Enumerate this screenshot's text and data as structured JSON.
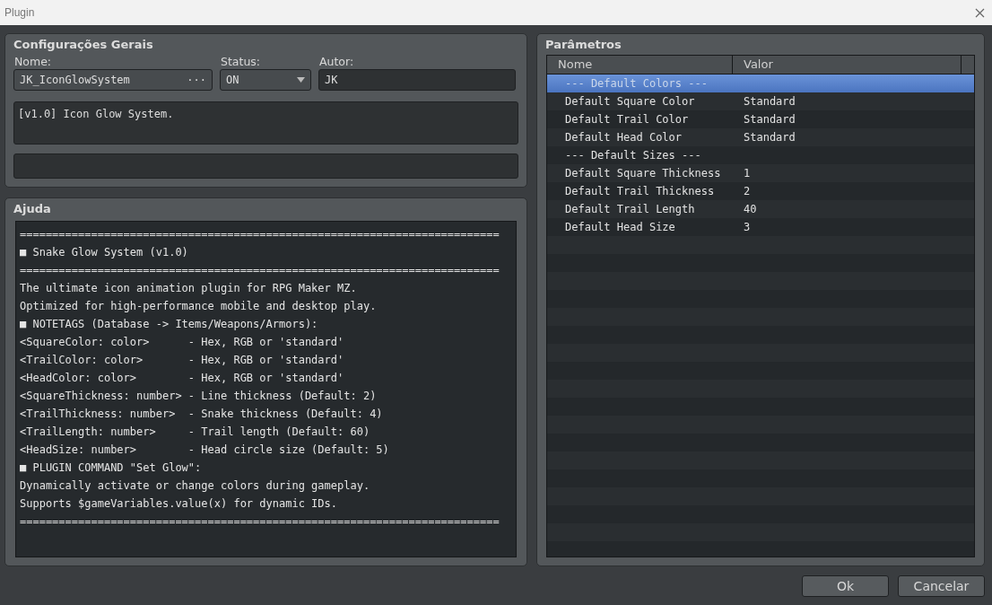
{
  "window": {
    "title": "Plugin"
  },
  "general": {
    "title": "Configurações Gerais",
    "name_label": "Nome:",
    "name_value": "JK_IconGlowSystem",
    "name_button": "···",
    "status_label": "Status:",
    "status_value": "ON",
    "author_label": "Autor:",
    "author_value": "JK",
    "description": "[v1.0] Icon Glow System."
  },
  "help": {
    "title": "Ajuda",
    "lines": [
      "==========================================================================",
      "■ Snake Glow System (v1.0)",
      "==========================================================================",
      "The ultimate icon animation plugin for RPG Maker MZ.",
      "Optimized for high-performance mobile and desktop play.",
      "■ NOTETAGS (Database -> Items/Weapons/Armors):",
      "<SquareColor: color>      - Hex, RGB or 'standard'",
      "<TrailColor: color>       - Hex, RGB or 'standard'",
      "<HeadColor: color>        - Hex, RGB or 'standard'",
      "<SquareThickness: number> - Line thickness (Default: 2)",
      "<TrailThickness: number>  - Snake thickness (Default: 4)",
      "<TrailLength: number>     - Trail length (Default: 60)",
      "<HeadSize: number>        - Head circle size (Default: 5)",
      "■ PLUGIN COMMAND \"Set Glow\":",
      "Dynamically activate or change colors during gameplay.",
      "Supports $gameVariables.value(x) for dynamic IDs.",
      "=========================================================================="
    ]
  },
  "parameters": {
    "title": "Parâmetros",
    "columns": [
      "Nome",
      "Valor"
    ],
    "rows": [
      {
        "name": "--- Default Colors ---",
        "value": "",
        "selected": true
      },
      {
        "name": "Default Square Color",
        "value": "Standard",
        "selected": false
      },
      {
        "name": "Default Trail Color",
        "value": "Standard",
        "selected": false
      },
      {
        "name": "Default Head Color",
        "value": "Standard",
        "selected": false
      },
      {
        "name": "--- Default Sizes ---",
        "value": "",
        "selected": false
      },
      {
        "name": "Default Square Thickness",
        "value": "1",
        "selected": false
      },
      {
        "name": "Default Trail Thickness",
        "value": "2",
        "selected": false
      },
      {
        "name": "Default Trail Length",
        "value": "40",
        "selected": false
      },
      {
        "name": "Default Head Size",
        "value": "3",
        "selected": false
      }
    ]
  },
  "buttons": [
    "Ok",
    "Cancelar"
  ]
}
